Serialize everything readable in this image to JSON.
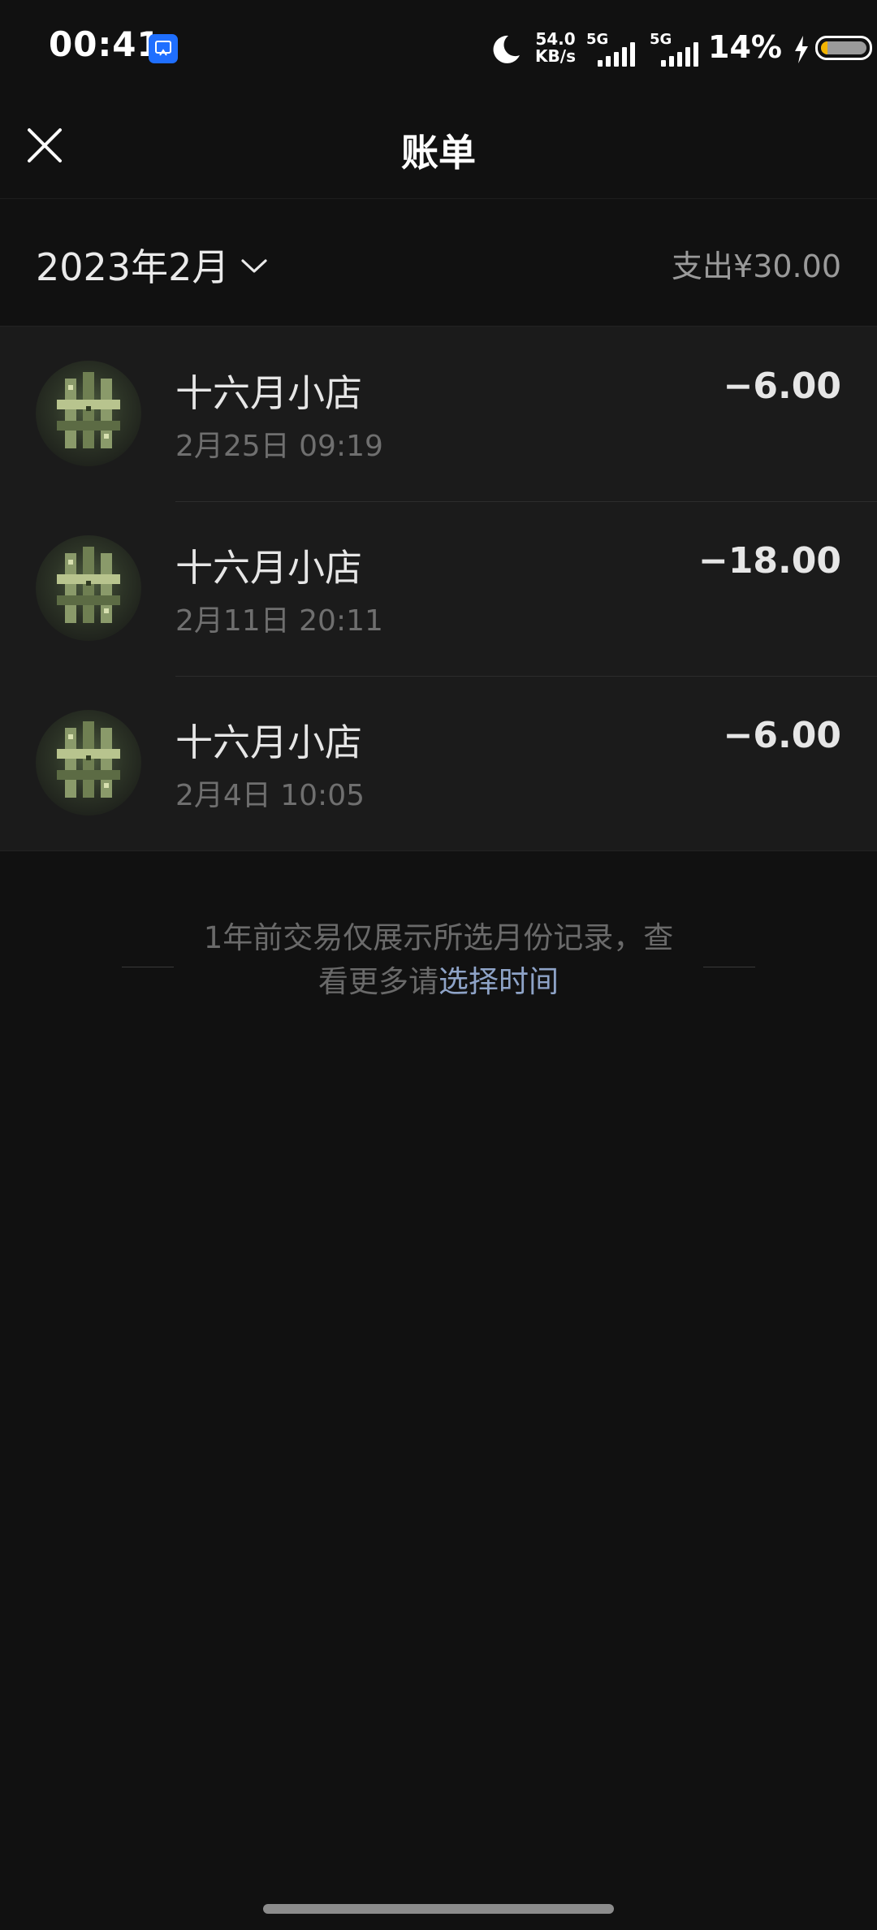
{
  "status_bar": {
    "time": "00:41",
    "net_speed_value": "54.0",
    "net_speed_unit": "KB/s",
    "sim1_type": "5G",
    "sim2_type": "5G",
    "battery_percent_text": "14%",
    "battery_level": 0.14,
    "icons": [
      "app-notification-icon",
      "moon-icon",
      "signal-icon",
      "charging-bolt-icon",
      "battery-icon"
    ]
  },
  "nav": {
    "title": "账单",
    "close_icon": "close-icon"
  },
  "month_bar": {
    "month_label": "2023年2月",
    "summary_label": "支出",
    "summary_amount": "¥30.00"
  },
  "transactions": [
    {
      "merchant": "十六月小店",
      "datetime": "2月25日 09:19",
      "amount": "−6.00"
    },
    {
      "merchant": "十六月小店",
      "datetime": "2月11日 20:11",
      "amount": "−18.00"
    },
    {
      "merchant": "十六月小店",
      "datetime": "2月4日 10:05",
      "amount": "−6.00"
    }
  ],
  "footer_note": {
    "text": "1年前交易仅展示所选月份记录，查看更多请",
    "link_text": "选择时间"
  },
  "colors": {
    "background": "#111111",
    "list_background": "#1b1b1b",
    "link": "#8ea3c7"
  }
}
